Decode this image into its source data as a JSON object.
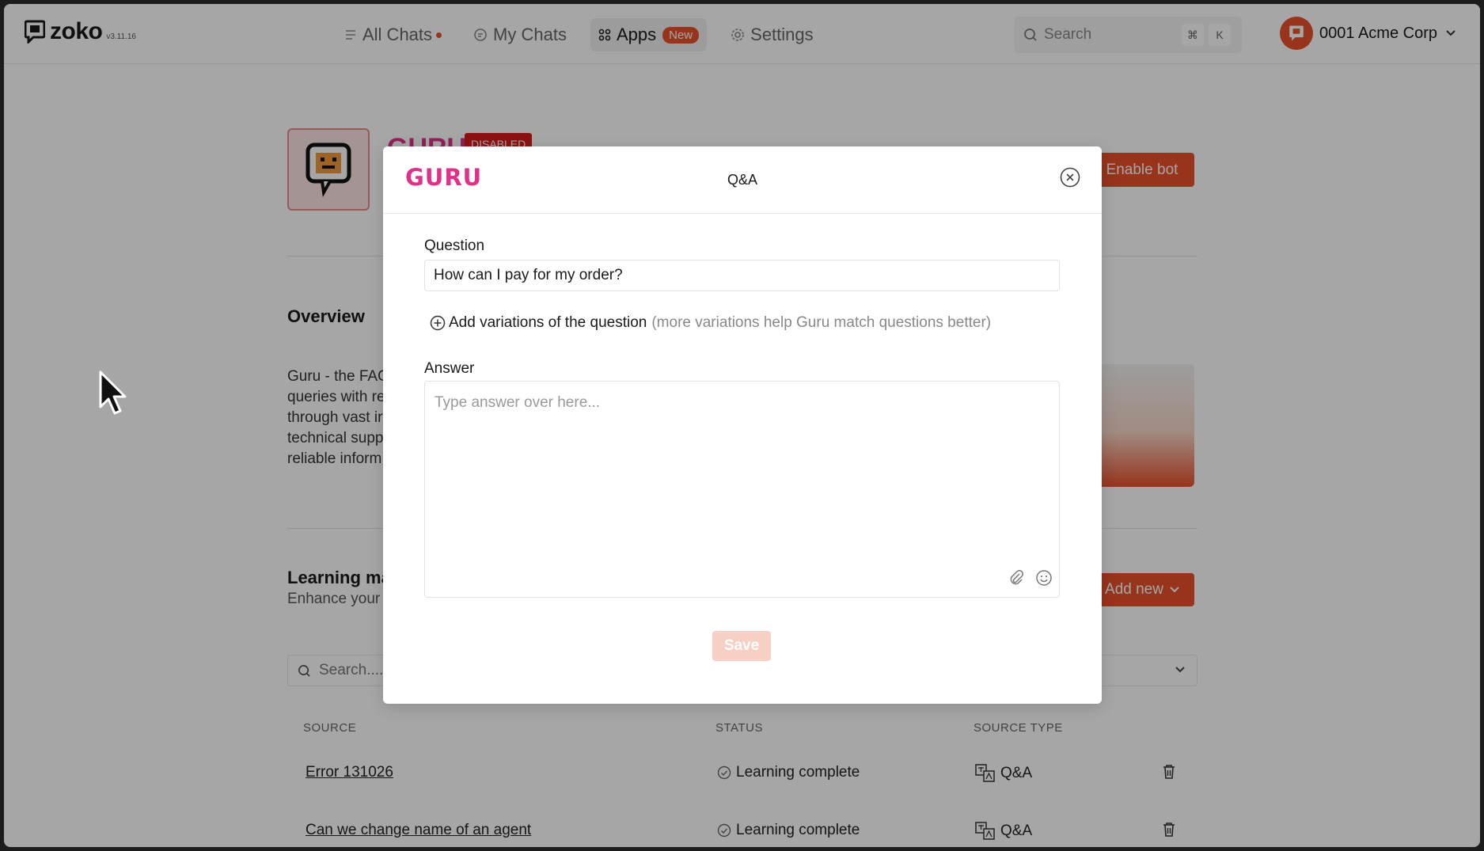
{
  "app": {
    "name": "zoko",
    "version": "v3.11.16"
  },
  "nav": {
    "items": [
      {
        "label": "All Chats",
        "icon": "list-icon"
      },
      {
        "label": "My Chats",
        "icon": "chat-icon"
      },
      {
        "label": "Apps",
        "icon": "grid-icon",
        "badge": "New"
      },
      {
        "label": "Settings",
        "icon": "gear-icon"
      }
    ]
  },
  "search": {
    "placeholder": "Search",
    "shortcut_key1": "⌘",
    "shortcut_key2": "K"
  },
  "account": {
    "name": "0001 Acme Corp"
  },
  "bot": {
    "title": "GURU",
    "status": "DISABLED",
    "enable_label": "Enable bot"
  },
  "overview": {
    "heading": "Overview",
    "text_lines": [
      "Guru - the FAC",
      "queries with re",
      "through vast ir",
      "technical supp",
      "reliable inform"
    ]
  },
  "learning": {
    "heading": "Learning ma",
    "sub": "Enhance your",
    "add_new_label": "Add new",
    "search_placeholder": "Search...."
  },
  "table": {
    "headers": [
      "SOURCE",
      "STATUS",
      "SOURCE TYPE"
    ],
    "rows": [
      {
        "source": "Error 131026",
        "status": "Learning complete",
        "type": "Q&A"
      },
      {
        "source": "Can we change name of an agent",
        "status": "Learning complete",
        "type": "Q&A"
      }
    ]
  },
  "modal": {
    "logo": "GURU",
    "title": "Q&A",
    "question_label": "Question",
    "question_value": "How can I pay for my order?",
    "add_variations": "Add variations of the question",
    "add_variations_hint": "(more variations help Guru match questions better)",
    "answer_label": "Answer",
    "answer_placeholder": "Type answer over here...",
    "save_label": "Save"
  },
  "colors": {
    "accent": "#e8512a",
    "guru_pink": "#e0308a",
    "disabled_red": "#d81d1d"
  }
}
